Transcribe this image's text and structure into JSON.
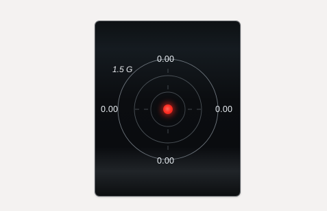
{
  "gauge": {
    "scale_label": "1.5 G",
    "readouts": {
      "top": "0.00",
      "bottom": "0.00",
      "left": "0.00",
      "right": "0.00"
    },
    "indicator_color": "#ff3126",
    "ring_color": "#6f777f"
  }
}
